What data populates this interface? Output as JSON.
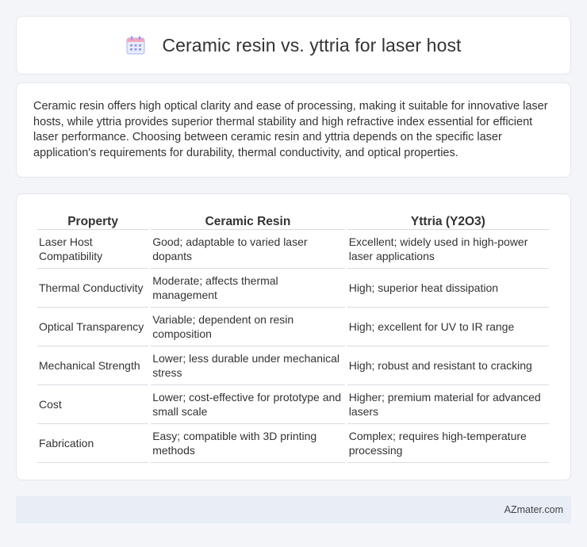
{
  "header": {
    "title": "Ceramic resin vs. yttria for laser host",
    "icon": "calendar-icon",
    "icon_color": "#7b8cf2"
  },
  "intro": {
    "text": "Ceramic resin offers high optical clarity and ease of processing, making it suitable for innovative laser hosts, while yttria provides superior thermal stability and high refractive index essential for efficient laser performance. Choosing between ceramic resin and yttria depends on the specific laser application's requirements for durability, thermal conductivity, and optical properties."
  },
  "table": {
    "headers": [
      "Property",
      "Ceramic Resin",
      "Yttria (Y2O3)"
    ],
    "rows": [
      [
        "Laser Host Compatibility",
        "Good; adaptable to varied laser dopants",
        "Excellent; widely used in high-power laser applications"
      ],
      [
        "Thermal Conductivity",
        "Moderate; affects thermal management",
        "High; superior heat dissipation"
      ],
      [
        "Optical Transparency",
        "Variable; dependent on resin composition",
        "High; excellent for UV to IR range"
      ],
      [
        "Mechanical Strength",
        "Lower; less durable under mechanical stress",
        "High; robust and resistant to cracking"
      ],
      [
        "Cost",
        "Lower; cost-effective for prototype and small scale",
        "Higher; premium material for advanced lasers"
      ],
      [
        "Fabrication",
        "Easy; compatible with 3D printing methods",
        "Complex; requires high-temperature processing"
      ]
    ]
  },
  "footer": {
    "text": "AZmater.com"
  }
}
